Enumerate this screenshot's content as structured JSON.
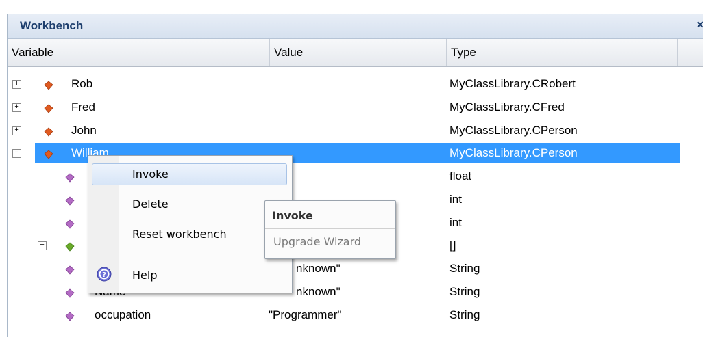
{
  "panel": {
    "title": "Workbench",
    "close_glyph": "×"
  },
  "columns": {
    "variable": "Variable",
    "value": "Value",
    "type": "Type"
  },
  "rows": [
    {
      "name": "Rob",
      "value": "",
      "type": "MyClassLibrary.CRobert"
    },
    {
      "name": "Fred",
      "value": "",
      "type": "MyClassLibrary.CFred"
    },
    {
      "name": "John",
      "value": "",
      "type": "MyClassLibrary.CPerson"
    },
    {
      "name": "William",
      "value": "",
      "type": "MyClassLibrary.CPerson"
    },
    {
      "name": "",
      "value": "",
      "type": "float"
    },
    {
      "name": "",
      "value": "",
      "type": "int"
    },
    {
      "name": "",
      "value": "",
      "type": "int"
    },
    {
      "name": "",
      "value": "",
      "type": "[]"
    },
    {
      "name": "",
      "value": "nknown\"",
      "type": "String"
    },
    {
      "name": "Name",
      "value": "nknown\"",
      "type": "String"
    },
    {
      "name": "occupation",
      "value": "\"Programmer\"",
      "type": "String"
    }
  ],
  "context_menu": {
    "items": [
      {
        "label": "Invoke"
      },
      {
        "label": "Delete"
      },
      {
        "label": "Reset workbench"
      },
      {
        "label": "Help"
      }
    ]
  },
  "submenu": {
    "header": "Invoke",
    "item": "Upgrade Wizard"
  },
  "colors": {
    "selection": "#3399ff",
    "object_icon": "#e05a20",
    "member_icon": "#b36bc4",
    "array_icon": "#6aaa2a",
    "title_text": "#1e3f6e"
  },
  "icons": {
    "object": "orange-diamond-icon",
    "member": "purple-diamond-icon",
    "array": "green-diamond-icon",
    "help": "help-circle-icon",
    "plus": "plus-box-icon",
    "minus": "minus-box-icon"
  }
}
